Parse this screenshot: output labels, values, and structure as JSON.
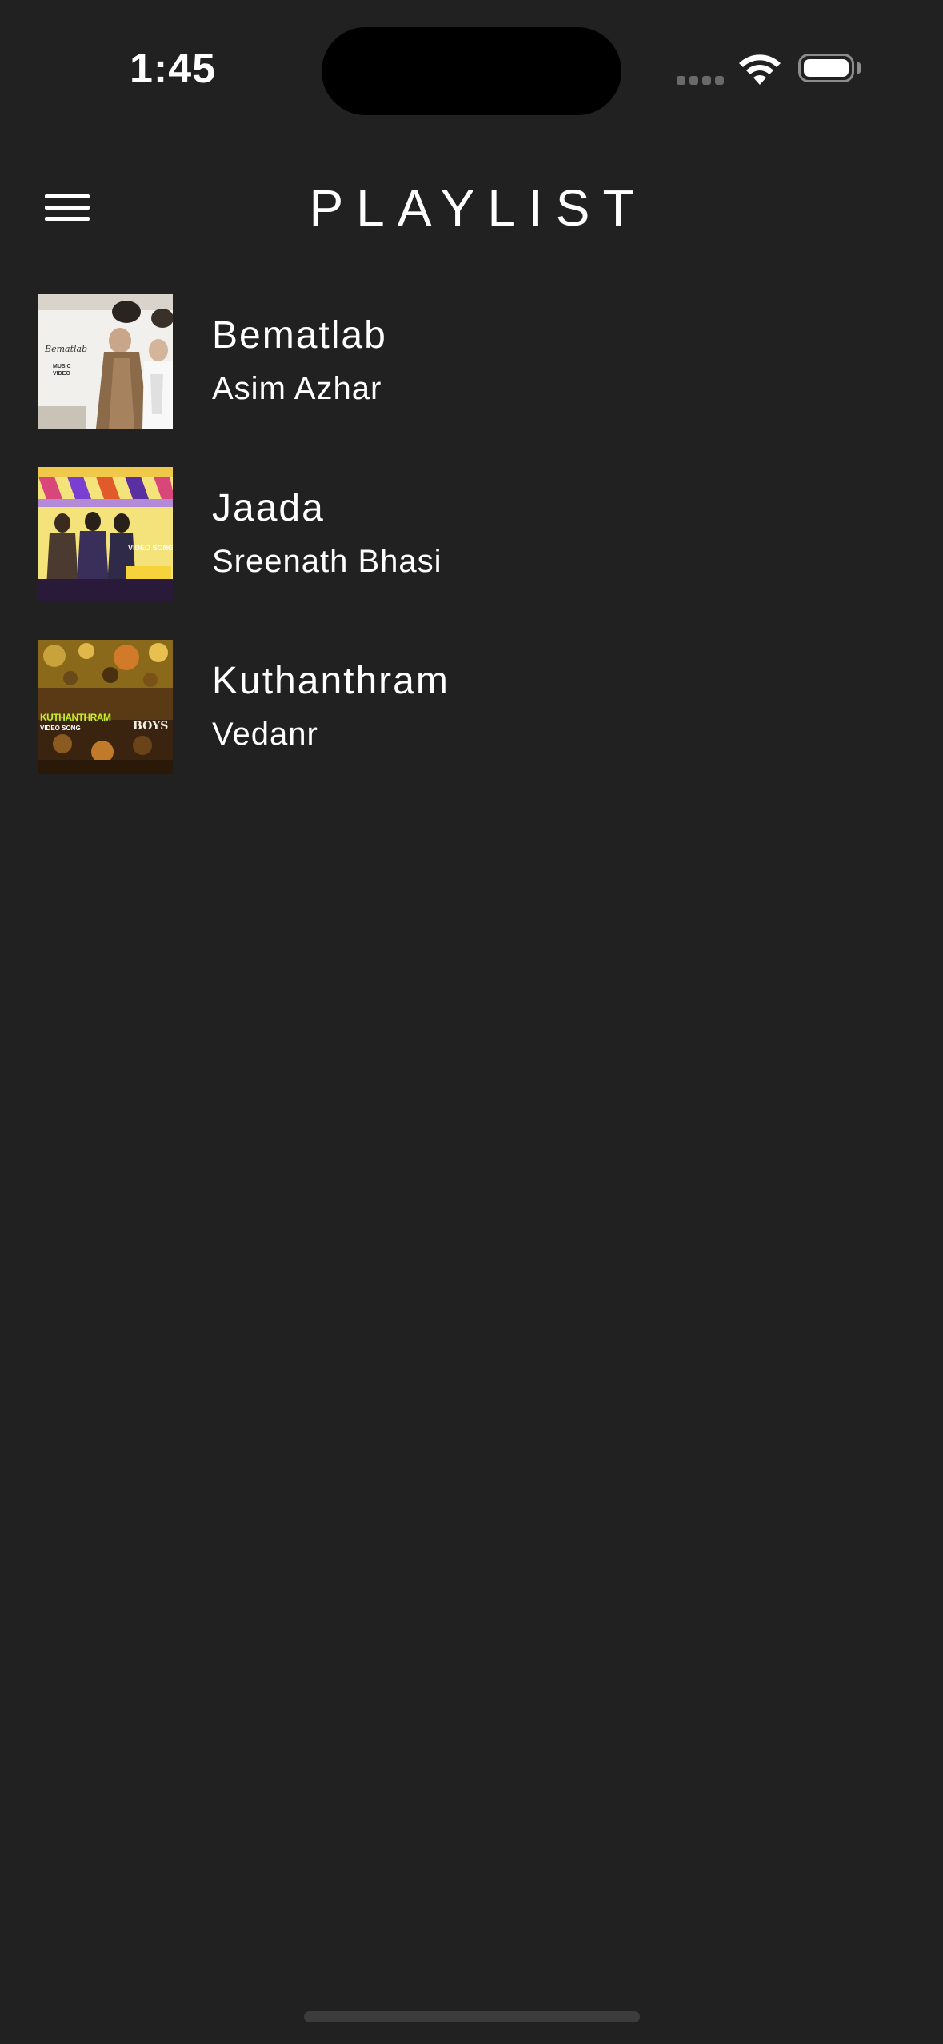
{
  "status_bar": {
    "time": "1:45"
  },
  "header": {
    "title": "PLAYLIST",
    "menu_icon": "hamburger-menu-icon"
  },
  "tracks": [
    {
      "title": "Bematlab",
      "artist": "Asim Azhar",
      "thumb_text": "Bematlab",
      "thumb_sub": "MUSIC VIDEO"
    },
    {
      "title": "Jaada",
      "artist": "Sreenath Bhasi",
      "thumb_text": "VIDEO SONG"
    },
    {
      "title": "Kuthanthram",
      "artist": "Vedanr",
      "thumb_text": "KUTHANTHRAM",
      "thumb_sub": "VIDEO SONG",
      "thumb_logo": "BOYS"
    }
  ],
  "colors": {
    "background": "#212121",
    "text": "#ffffff",
    "island": "#000000"
  }
}
